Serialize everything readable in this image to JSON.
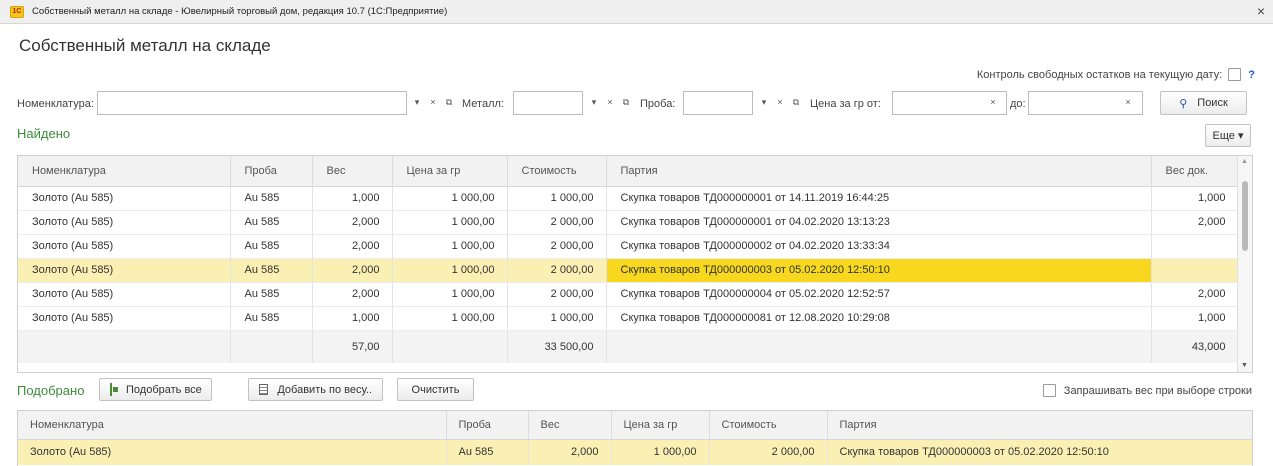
{
  "window": {
    "title": "Собственный металл на складе - Ювелирный торговый дом, редакция 10.7 (1С:Предприятие)",
    "app_icon_text": "1С",
    "close_glyph": "×"
  },
  "page_title": "Собственный металл на складе",
  "control_free_balance": {
    "label": "Контроль свободных остатков на текущую дату:",
    "checked": false,
    "help": "?"
  },
  "filters": {
    "nomenclature_label": "Номенклатура:",
    "nomenclature_value": "",
    "metal_label": "Металл:",
    "metal_value": "",
    "assay_label": "Проба:",
    "assay_value": "",
    "price_from_label": "Цена за гр от:",
    "price_from_value": "",
    "price_to_label": "до:",
    "price_to_value": "",
    "dropdown_glyph": "▾",
    "clear_glyph": "×",
    "open_glyph": "⧉",
    "search_button": "Поиск",
    "search_icon": "magnifier-icon"
  },
  "found": {
    "label": "Найдено",
    "more_button": "Еще ▾",
    "columns": [
      "Номенклатура",
      "Проба",
      "Вес",
      "Цена за гр",
      "Стоимость",
      "Партия",
      "Вес док."
    ],
    "rows": [
      {
        "nomenclature": "Золото (Au 585)",
        "assay": "Au 585",
        "weight": "1,000",
        "price": "1 000,00",
        "cost": "1 000,00",
        "batch": "Скупка товаров ТД000000001 от 14.11.2019 16:44:25",
        "doc_weight": "1,000"
      },
      {
        "nomenclature": "Золото (Au 585)",
        "assay": "Au 585",
        "weight": "2,000",
        "price": "1 000,00",
        "cost": "2 000,00",
        "batch": "Скупка товаров ТД000000001 от 04.02.2020 13:13:23",
        "doc_weight": "2,000"
      },
      {
        "nomenclature": "Золото (Au 585)",
        "assay": "Au 585",
        "weight": "2,000",
        "price": "1 000,00",
        "cost": "2 000,00",
        "batch": "Скупка товаров ТД000000002 от 04.02.2020 13:33:34",
        "doc_weight": ""
      },
      {
        "nomenclature": "Золото (Au 585)",
        "assay": "Au 585",
        "weight": "2,000",
        "price": "1 000,00",
        "cost": "2 000,00",
        "batch": "Скупка товаров ТД000000003 от 05.02.2020 12:50:10",
        "doc_weight": ""
      },
      {
        "nomenclature": "Золото (Au 585)",
        "assay": "Au 585",
        "weight": "2,000",
        "price": "1 000,00",
        "cost": "2 000,00",
        "batch": "Скупка товаров ТД000000004 от 05.02.2020 12:52:57",
        "doc_weight": "2,000"
      },
      {
        "nomenclature": "Золото (Au 585)",
        "assay": "Au 585",
        "weight": "1,000",
        "price": "1 000,00",
        "cost": "1 000,00",
        "batch": "Скупка товаров ТД000000081 от 12.08.2020 10:29:08",
        "doc_weight": "1,000"
      }
    ],
    "selected_row_index": 3,
    "totals": {
      "nomenclature": "",
      "assay": "",
      "weight": "57,00",
      "price": "",
      "cost": "33 500,00",
      "batch": "",
      "doc_weight": "43,000"
    }
  },
  "picked": {
    "label": "Подобрано",
    "pick_all_button": "Подобрать все",
    "add_by_weight_button": "Добавить по весу..",
    "clear_button": "Очистить",
    "ask_weight_label": "Запрашивать вес при выборе строки",
    "ask_weight_checked": false,
    "columns": [
      "Номенклатура",
      "Проба",
      "Вес",
      "Цена за гр",
      "Стоимость",
      "Партия"
    ],
    "rows": [
      {
        "nomenclature": "Золото (Au 585)",
        "assay": "Au 585",
        "weight": "2,000",
        "price": "1 000,00",
        "cost": "2 000,00",
        "batch": "Скупка товаров ТД000000003 от 05.02.2020 12:50:10"
      }
    ]
  },
  "colors": {
    "accent_green": "#3c8a3c",
    "selected_row": "#fbf0b3",
    "selected_cell": "#f7d81e",
    "link_blue": "#1f5ecf"
  }
}
